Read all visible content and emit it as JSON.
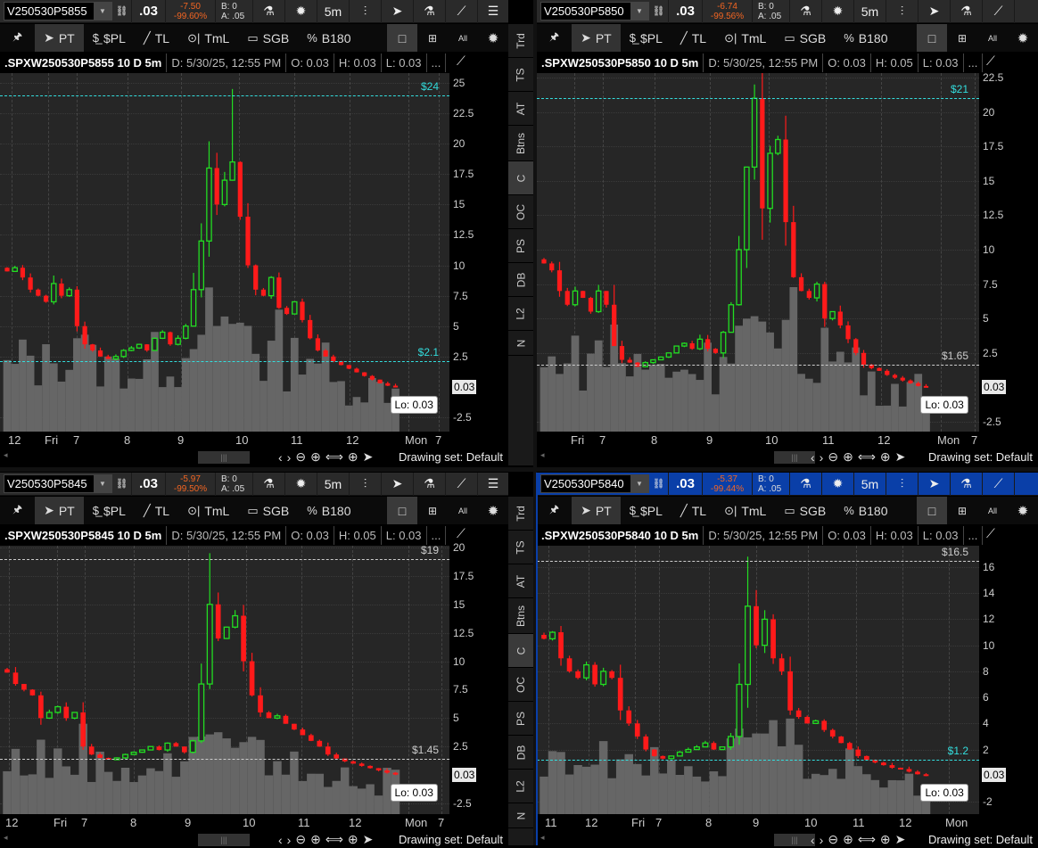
{
  "side_tabs": [
    "Trd",
    "TS",
    "AT",
    "Btns",
    "C",
    "OC",
    "PS",
    "DB",
    "L2",
    "N"
  ],
  "side_selected": "C",
  "toolbar": {
    "pin": "🖈",
    "pt": "PT",
    "spl": "$PL",
    "tl": "TL",
    "tml": "TmL",
    "sgb": "SGB",
    "b180": "B180",
    "all": "All"
  },
  "header_icons": {
    "interval": "5m"
  },
  "scroll": {
    "drawing_set": "Drawing set: Default"
  },
  "colors": {
    "up": "#22dd22",
    "down": "#ff1a1a",
    "volume": "#666666",
    "chart_bg": "#262626",
    "level_cyan": "#33dddd",
    "level_white": "#cccccc",
    "active_header": "#0a3fa8",
    "change": "#f26522"
  },
  "panels": [
    {
      "symbol": "V250530P5855",
      "last": ".03",
      "change": "-7.50",
      "change_pct": "-99.60%",
      "bid": "B: 0",
      "ask": "A: .05",
      "title": ".SPXW250530P5855 10 D 5m",
      "date": "D: 5/30/25, 12:55 PM",
      "open": "O: 0.03",
      "high": "H: 0.03",
      "low": "L: 0.03",
      "more": "...",
      "y_ticks": [
        "25",
        "22.5",
        "20",
        "17.5",
        "15",
        "12.5",
        "10",
        "7.5",
        "5",
        "2.5",
        "-2.5"
      ],
      "y_range": [
        -2.5,
        25
      ],
      "price_box": "0.03",
      "lo_label": "Lo: 0.03",
      "levels": [
        {
          "label": "$24",
          "price": 24,
          "color": "cyan"
        },
        {
          "label": "$2.1",
          "price": 2.1,
          "color": "cyan"
        }
      ],
      "time_labels": [
        "12",
        "Fri",
        "7",
        "8",
        "9",
        "10",
        "11",
        "12",
        "Mon",
        "7"
      ],
      "spike_high": 24.5,
      "closes": [
        9.5,
        9.8,
        9,
        8,
        7.5,
        7,
        8.5,
        7.5,
        8,
        5,
        3.5,
        3,
        2.5,
        2.3,
        2.5,
        3,
        3.2,
        3.5,
        3,
        4,
        4.5,
        3.5,
        4,
        5,
        8,
        12,
        18,
        15,
        17,
        18.5,
        14,
        10,
        8,
        7.5,
        9,
        6.5,
        6,
        7,
        5.5,
        4,
        3,
        2.5,
        2.1,
        1.8,
        1.5,
        1.2,
        0.9,
        0.6,
        0.3,
        0.1,
        0.03
      ]
    },
    {
      "symbol": "V250530P5850",
      "last": ".03",
      "change": "-6.74",
      "change_pct": "-99.56%",
      "bid": "B: 0",
      "ask": "A: .05",
      "title": ".SPXW250530P5850 10 D 5m",
      "date": "D: 5/30/25, 12:55 PM",
      "open": "O: 0.03",
      "high": "H: 0.05",
      "low": "L: 0.03",
      "more": "...",
      "y_ticks": [
        "22.5",
        "20",
        "17.5",
        "15",
        "12.5",
        "10",
        "7.5",
        "5",
        "2.5",
        "-2.5"
      ],
      "y_range": [
        -2.5,
        22.5
      ],
      "price_box": "0.03",
      "lo_label": "Lo: 0.03",
      "levels": [
        {
          "label": "$21",
          "price": 21,
          "color": "cyan"
        },
        {
          "label": "$1.65",
          "price": 1.65,
          "color": "white"
        }
      ],
      "time_labels": [
        "Fri",
        "7",
        "8",
        "9",
        "10",
        "11",
        "12",
        "Mon",
        "7"
      ],
      "spike_high": 22,
      "closes": [
        9,
        8.5,
        7,
        6,
        7,
        6.5,
        5.5,
        7,
        6,
        3,
        2,
        1.8,
        1.5,
        1.8,
        2,
        2.2,
        2.5,
        3,
        3.2,
        2.8,
        3.5,
        2.8,
        2.5,
        4,
        6,
        10,
        16,
        21,
        13,
        17,
        18,
        12,
        8,
        7,
        6.5,
        7.5,
        5,
        5.5,
        4.5,
        3.5,
        2.5,
        1.65,
        1.4,
        1.2,
        0.9,
        0.7,
        0.5,
        0.3,
        0.1,
        0.03
      ]
    },
    {
      "symbol": "V250530P5845",
      "last": ".03",
      "change": "-5.97",
      "change_pct": "-99.50%",
      "bid": "B: 0",
      "ask": "A: .05",
      "title": ".SPXW250530P5845 10 D 5m",
      "date": "D: 5/30/25, 12:55 PM",
      "open": "O: 0.03",
      "high": "H: 0.05",
      "low": "L: 0.03",
      "more": "...",
      "y_ticks": [
        "20",
        "17.5",
        "15",
        "12.5",
        "10",
        "7.5",
        "5",
        "2.5",
        "-2.5"
      ],
      "y_range": [
        -2.5,
        20
      ],
      "price_box": "0.03",
      "lo_label": "Lo: 0.03",
      "levels": [
        {
          "label": "$19",
          "price": 19,
          "color": "white"
        },
        {
          "label": "$1.45",
          "price": 1.45,
          "color": "white"
        }
      ],
      "time_labels": [
        "12",
        "Fri",
        "7",
        "8",
        "9",
        "10",
        "11",
        "12",
        "Mon",
        "7"
      ],
      "spike_high": 19.5,
      "closes": [
        9,
        8,
        7.5,
        7,
        5,
        5.5,
        6,
        5,
        5.5,
        2.5,
        1.8,
        1.5,
        1.4,
        1.5,
        1.8,
        2,
        2.2,
        2.5,
        2.2,
        2.8,
        2.5,
        2,
        3,
        8,
        15,
        12,
        13,
        14,
        10,
        7,
        5.5,
        5,
        5.2,
        4.5,
        4,
        3.5,
        3,
        2.5,
        1.8,
        1.45,
        1.2,
        1,
        0.8,
        0.6,
        0.4,
        0.2,
        0.03
      ]
    },
    {
      "symbol": "V250530P5840",
      "last": ".03",
      "change": "-5.37",
      "change_pct": "-99.44%",
      "bid": "B: 0",
      "ask": "A: .05",
      "title": ".SPXW250530P5840 10 D 5m",
      "date": "D: 5/30/25, 12:55 PM",
      "open": "O: 0.03",
      "high": "H: 0.03",
      "low": "L: 0.03",
      "more": "...",
      "y_ticks": [
        "16",
        "14",
        "12",
        "10",
        "8",
        "6",
        "4",
        "2",
        "-2"
      ],
      "y_range": [
        -2,
        16
      ],
      "price_box": "0.03",
      "lo_label": "Lo: 0.03",
      "levels": [
        {
          "label": "$16.5",
          "price": 16.5,
          "color": "white"
        },
        {
          "label": "$1.2",
          "price": 1.2,
          "color": "cyan"
        }
      ],
      "time_labels": [
        "11",
        "12",
        "Fri",
        "7",
        "8",
        "9",
        "10",
        "11",
        "12",
        "Mon"
      ],
      "spike_high": 16.8,
      "closes": [
        10.5,
        11,
        9,
        8,
        7.5,
        8.5,
        7,
        8,
        7.5,
        5,
        4,
        3,
        2,
        1.5,
        1.3,
        1.5,
        1.8,
        2,
        2.2,
        2.5,
        2,
        2.2,
        3,
        7,
        13,
        10,
        12,
        9,
        8,
        5,
        4.5,
        4,
        4.2,
        3.5,
        3,
        2.5,
        2,
        1.5,
        1.2,
        1,
        0.8,
        0.6,
        0.5,
        0.3,
        0.1,
        0.03
      ]
    }
  ]
}
